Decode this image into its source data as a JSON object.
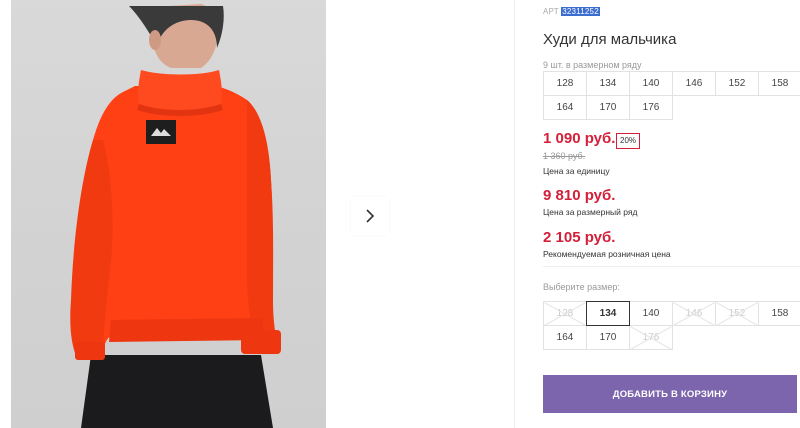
{
  "product": {
    "sku_label": "АРТ",
    "sku_value": "32311252",
    "title": "Худи для мальчика",
    "image_alt": "product-photo-hoodie-back-view"
  },
  "size_range": {
    "label": "9 шт. в размерном ряду",
    "sizes": [
      "128",
      "134",
      "140",
      "146",
      "152",
      "158",
      "164",
      "170",
      "176"
    ]
  },
  "pricing": {
    "price": "1 090 руб.",
    "discount": "20%",
    "old_price": "1 360 руб.",
    "price_note": "Цена за единицу",
    "range_price": "9 810 руб.",
    "range_note": "Цена за размерный ряд",
    "retail_price": "2 105 руб.",
    "retail_note": "Рекомендуемая розничная цена"
  },
  "size_picker": {
    "label": "Выберите размер:",
    "options": [
      {
        "size": "128",
        "available": false,
        "selected": false
      },
      {
        "size": "134",
        "available": true,
        "selected": true
      },
      {
        "size": "140",
        "available": true,
        "selected": false
      },
      {
        "size": "146",
        "available": false,
        "selected": false
      },
      {
        "size": "152",
        "available": false,
        "selected": false
      },
      {
        "size": "158",
        "available": true,
        "selected": false
      },
      {
        "size": "164",
        "available": true,
        "selected": false
      },
      {
        "size": "170",
        "available": true,
        "selected": false
      },
      {
        "size": "176",
        "available": false,
        "selected": false
      }
    ]
  },
  "actions": {
    "add_to_cart": "ДОБАВИТЬ В КОРЗИНУ"
  },
  "colors": {
    "price": "#d41f3a",
    "button": "#7d65ad",
    "hoodie": "#ff3f14"
  },
  "icons": {
    "gallery_next": "chevron-right-icon"
  }
}
